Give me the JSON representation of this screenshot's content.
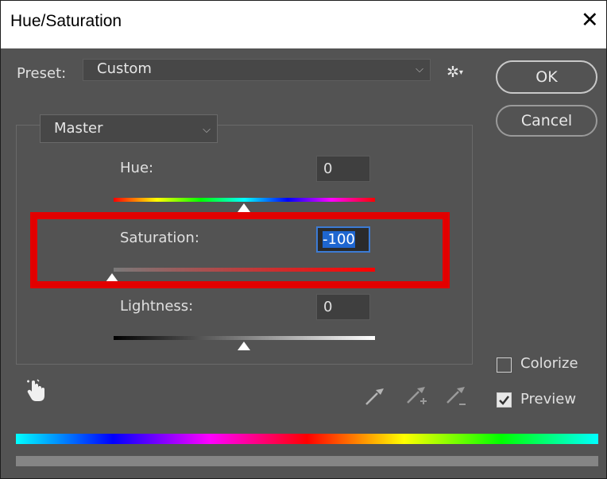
{
  "title": "Hue/Saturation",
  "close_glyph": "✕",
  "preset": {
    "label": "Preset:",
    "value": "Custom"
  },
  "buttons": {
    "ok": "OK",
    "cancel": "Cancel"
  },
  "channel": "Master",
  "adjustments": {
    "hue": {
      "label": "Hue:",
      "value": "0"
    },
    "saturation": {
      "label": "Saturation:",
      "value": "-100"
    },
    "lightness": {
      "label": "Lightness:",
      "value": "0"
    }
  },
  "colorize": {
    "label": "Colorize",
    "checked": false
  },
  "preview": {
    "label": "Preview",
    "checked": true
  },
  "highlight_color": "#e20000",
  "icons": [
    "gear-icon",
    "targeted-adjustment-hand-icon",
    "eyedropper-icon",
    "eyedropper-plus-icon",
    "eyedropper-minus-icon"
  ]
}
